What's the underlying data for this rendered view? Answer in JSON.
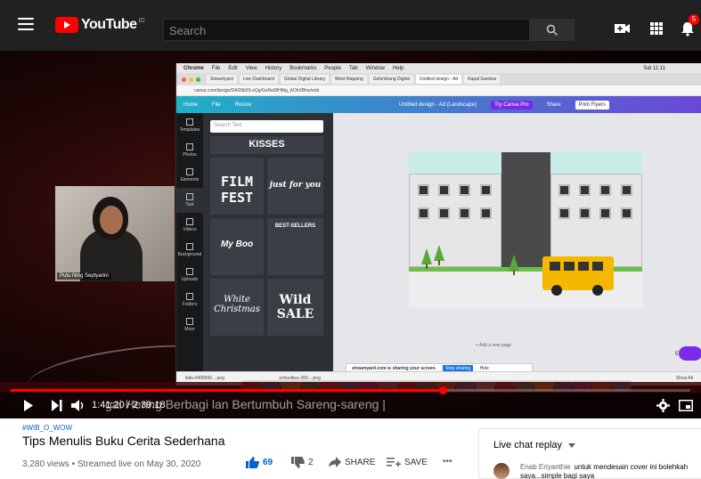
{
  "header": {
    "logo_text": "YouTube",
    "country_code": "ID",
    "search_placeholder": "Search",
    "notification_count": "5"
  },
  "player": {
    "current_time": "1:41:20",
    "duration": "2:39:18",
    "time_separator": "/",
    "ticker_text": "gai Hering Berbagi lan Bertumbuh Sareng-sareng |",
    "progress_fraction": 0.636,
    "accent_color": "#ff0000",
    "webcam_name": "Putu Ning Septyarini"
  },
  "screen_share": {
    "mac_menu": [
      "Chrome",
      "File",
      "Edit",
      "View",
      "History",
      "Bookmarks",
      "People",
      "Tab",
      "Window",
      "Help"
    ],
    "clock": "Sat 11:11",
    "tabs": [
      "Streamyard",
      "Live Dashboard",
      "Global Digital Library",
      "Mind Mapping",
      "Gelombang Digital",
      "Untitled design - Ad",
      "Kapal Gambar"
    ],
    "address": "canva.com/design/DAD9k5S-xQg/GoNs08HMg_AOhXBhw/edit",
    "canva_menu": [
      "Home",
      "File",
      "Resize",
      "Untitled design - Ad (Landscape)",
      "Try Canva Pro",
      "Share",
      "Print Flyers"
    ],
    "side_items": [
      "Templates",
      "Photos",
      "Elements",
      "Text",
      "Videos",
      "Background",
      "Uploads",
      "Folders",
      "More"
    ],
    "panel_search": "Search Text",
    "templates": [
      "KISSES",
      "FILM FEST",
      "just for you",
      "My Boo",
      "BEST-SELLERS",
      "White Christmas",
      "Wild SALE"
    ],
    "add_page": "+ Add a new page",
    "zoom": "57%",
    "share_notice": "streamyard.com is sharing your screen.",
    "share_stop": "Stop sharing",
    "share_hide": "Hide",
    "downloads": [
      "kids-0400092....png",
      "schoolbus-300....png"
    ],
    "show_all": "Show All"
  },
  "video": {
    "hashtag": "#WIB_O_WOW",
    "title": "Tips Menulis Buku Cerita Sederhana",
    "views_date": "3,280 views • Streamed live on May 30, 2020",
    "likes": "69",
    "dislikes": "2",
    "share_label": "SHARE",
    "save_label": "SAVE",
    "more_label": "•••"
  },
  "chat": {
    "header": "Live chat replay",
    "author": "Enab Eriyanthie",
    "message": "untuk mendesain cover ini bolehkah saya...simple bagi saya"
  }
}
